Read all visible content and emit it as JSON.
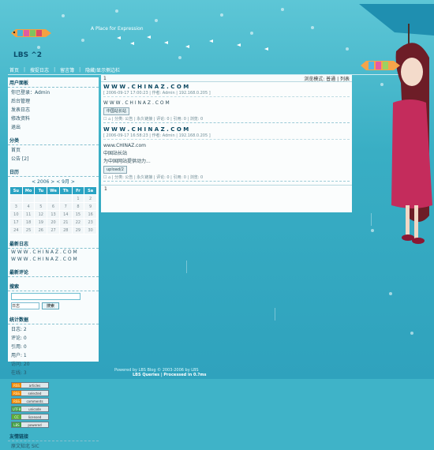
{
  "header": {
    "tagline": "A Place for Expression",
    "logo": "LBS ^2"
  },
  "nav": {
    "items": [
      "首页",
      "搜捉日志",
      "留言簿",
      "隐藏/显示侧边栏"
    ]
  },
  "sidebar": {
    "user_panel_title": "用户面板",
    "login_status": "你已登录：Admin",
    "user_links": [
      "后台管理",
      "发表日志",
      "修改资料",
      "退出"
    ],
    "category_title": "分类",
    "categories": [
      "首页",
      "公告 [2]"
    ],
    "calendar_title": "日历",
    "calendar_year": "< 2006 >",
    "calendar_month": "< 9月 >",
    "week_days": [
      "Su",
      "Mo",
      "Tu",
      "We",
      "Th",
      "Fr",
      "Sa"
    ],
    "calendar_weeks": [
      [
        "",
        "",
        "",
        "",
        "",
        "1",
        "2"
      ],
      [
        "3",
        "4",
        "5",
        "6",
        "7",
        "8",
        "9"
      ],
      [
        "10",
        "11",
        "12",
        "13",
        "14",
        "15",
        "16"
      ],
      [
        "17",
        "18",
        "19",
        "20",
        "21",
        "22",
        "23"
      ],
      [
        "24",
        "25",
        "26",
        "27",
        "28",
        "29",
        "30"
      ]
    ],
    "latest_entries_title": "最新日志",
    "latest_entries": [
      "W W W . C H I N A Z . C O M",
      "W W W . C H I N A Z . C O M"
    ],
    "latest_comments_title": "最新评论",
    "search_title": "搜索",
    "search_select": "日志",
    "search_button": "搜索",
    "stats_title": "统计数据",
    "stats": [
      "日志: 2",
      "评论: 0",
      "引用: 0",
      "用户: 1",
      "访问: 20",
      "在线: 3"
    ],
    "badges": [
      {
        "a": "RSS",
        "b": "articles"
      },
      {
        "a": "RSS",
        "b": "selected"
      },
      {
        "a": "RSS",
        "b": "comments"
      },
      {
        "a": "UTF8",
        "b": "unicode"
      },
      {
        "a": "CC",
        "b": "licensed"
      },
      {
        "a": "LBS",
        "b": "powered"
      }
    ],
    "links_title": "友情链接",
    "links": [
      "原文知北 SIC"
    ]
  },
  "main": {
    "page_num": "1",
    "view_mode_label": "浏览模式: 普通 | 列表",
    "entries": [
      {
        "title": "W W W . C H I N A Z . C O M",
        "meta": "[ 2006-09-17 17:00:23 | 作者: Admin | 192.168.0.205 ]",
        "lines": [
          "W W W . C H I N A Z . C O M"
        ],
        "image_label": "中国站长站",
        "footer": "| 分类: 公告 | 永久链接 | 评论: 0 | 引用: 0 | 浏览: 0"
      },
      {
        "title": "W W W . C H I N A Z . C O M",
        "meta": "[ 2006-09-17 16:58:23 | 作者: Admin | 192.168.0.205 ]",
        "lines": [
          "www.CHINAZ.com",
          "中国站长站",
          "为中国网站提供动力..."
        ],
        "image_label": "upload/2",
        "footer": "| 分类: 公告 | 永久链接 | 评论: 0 | 引用: 0 | 浏览: 0"
      }
    ],
    "page_num_bottom": "1"
  },
  "footer": {
    "line1": "Powered by LBS Blog © 2003-2006 by LBS",
    "line2": "LBS Queries | Processed in 0.?ms"
  }
}
